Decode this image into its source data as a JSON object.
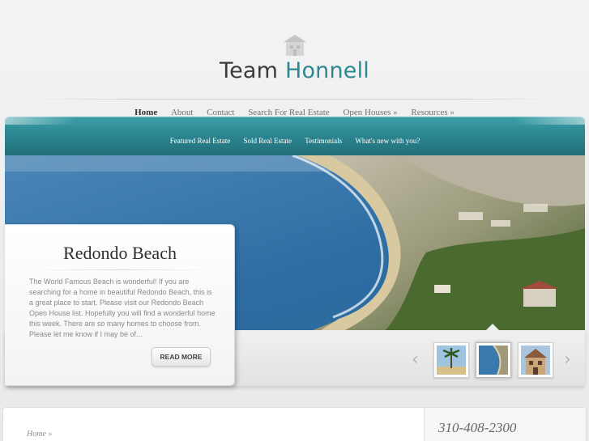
{
  "brand": {
    "name_part1": "Team",
    "name_part2": "Honnell",
    "logo_icon": "house-icon",
    "accent_color": "#2c8993"
  },
  "main_nav": [
    {
      "label": "Home",
      "active": true
    },
    {
      "label": "About"
    },
    {
      "label": "Contact"
    },
    {
      "label": "Search For Real Estate"
    },
    {
      "label": "Open Houses »"
    },
    {
      "label": "Resources »"
    }
  ],
  "sub_nav": [
    {
      "label": "Featured Real Estate"
    },
    {
      "label": "Sold Real Estate"
    },
    {
      "label": "Testimonials"
    },
    {
      "label": "What's new with you?"
    }
  ],
  "feature": {
    "title": "Redondo Beach",
    "text": "The World Famous Beach is wonderful! If you are searching for a home in beautiful Redondo Beach, this is a great place to start. Please visit our Redondo Beach Open House list. Hopefully you will find a wonderful home this week. There are so many homes to choose from. Please let me know if I may be of...",
    "button": "READ MORE"
  },
  "slider": {
    "prev_icon": "chevron-left-icon",
    "next_icon": "chevron-right-icon",
    "thumbnails": [
      {
        "name": "palm-tree-thumbnail"
      },
      {
        "name": "beach-aerial-thumbnail",
        "active": true
      },
      {
        "name": "house-thumbnail"
      }
    ]
  },
  "content": {
    "breadcrumb": "Home »",
    "phone": "310-408-2300"
  },
  "colors": {
    "teal_bar": "#2b8792",
    "background": "#ececec"
  }
}
